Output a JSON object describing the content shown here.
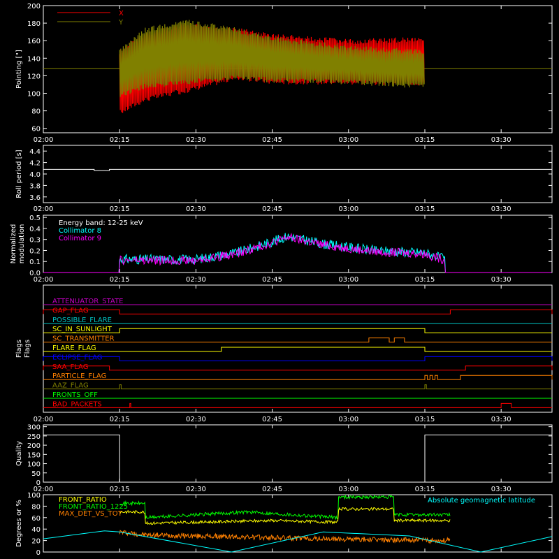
{
  "chart_data": [
    {
      "id": "pointing",
      "type": "line",
      "ylabel": "Pointing [\"]",
      "ylim": [
        55,
        200
      ],
      "yticks": [
        60,
        80,
        100,
        120,
        140,
        160,
        180,
        200
      ],
      "x_tick_labels": [
        "02:00",
        "02:15",
        "02:30",
        "02:45",
        "03:00",
        "03:15",
        "03:30"
      ],
      "legend": [
        {
          "label": "X",
          "color": "#ff0000"
        },
        {
          "label": "Y",
          "color": "#808000"
        }
      ],
      "reference_line": {
        "y": 128,
        "color": "#808000"
      },
      "series": [
        {
          "name": "X",
          "color": "#ff0000",
          "x": [
            "02:15",
            "02:20",
            "02:28",
            "02:38",
            "02:45",
            "03:00",
            "03:15"
          ],
          "upper": [
            150,
            170,
            180,
            175,
            168,
            162,
            165
          ],
          "lower": [
            75,
            90,
            100,
            115,
            110,
            110,
            108
          ]
        },
        {
          "name": "Y",
          "color": "#808000",
          "x": [
            "02:15",
            "02:20",
            "02:28",
            "02:38",
            "02:45",
            "03:00",
            "03:15"
          ],
          "upper": [
            150,
            175,
            185,
            175,
            165,
            155,
            150
          ],
          "lower": [
            95,
            105,
            110,
            115,
            112,
            110,
            105
          ]
        }
      ]
    },
    {
      "id": "roll",
      "type": "line",
      "ylabel": "Roll period [s]",
      "ylim": [
        3.5,
        4.5
      ],
      "yticks": [
        3.6,
        3.8,
        4.0,
        4.2,
        4.4
      ],
      "x_tick_labels": [
        "02:00",
        "02:15",
        "02:30",
        "02:45",
        "03:00",
        "03:15",
        "03:30"
      ],
      "series": [
        {
          "name": "roll",
          "color": "#ffffff",
          "x": [
            "02:00",
            "02:10",
            "02:10",
            "02:13",
            "02:13",
            "03:40"
          ],
          "y": [
            4.08,
            4.08,
            4.06,
            4.06,
            4.08,
            4.08
          ]
        }
      ]
    },
    {
      "id": "modulation",
      "type": "line",
      "ylabel": "Normalized modulation",
      "ylim": [
        0,
        0.52
      ],
      "yticks": [
        0.0,
        0.1,
        0.2,
        0.3,
        0.4,
        0.5
      ],
      "x_tick_labels": [
        "02:00",
        "02:15",
        "02:30",
        "02:45",
        "03:00",
        "03:15",
        "03:30"
      ],
      "annotation": "Energy band: 12-25 keV",
      "legend": [
        {
          "label": "Collimator 8",
          "color": "#00ffff"
        },
        {
          "label": "Collimator 9",
          "color": "#ff00ff"
        }
      ],
      "series": [
        {
          "name": "Collimator 8",
          "color": "#00ffff",
          "x": [
            "02:00",
            "02:15",
            "02:15",
            "02:30",
            "02:38",
            "02:45",
            "02:48",
            "02:55",
            "03:05",
            "03:15",
            "03:19",
            "03:19",
            "03:40"
          ],
          "y": [
            0,
            0,
            0.12,
            0.12,
            0.18,
            0.28,
            0.33,
            0.26,
            0.2,
            0.18,
            0.12,
            0,
            0
          ]
        },
        {
          "name": "Collimator 9",
          "color": "#ff00ff",
          "x": [
            "02:00",
            "02:15",
            "02:15",
            "02:30",
            "02:38",
            "02:45",
            "02:48",
            "02:55",
            "03:05",
            "03:15",
            "03:19",
            "03:19",
            "03:40"
          ],
          "y": [
            0,
            0,
            0.11,
            0.11,
            0.17,
            0.27,
            0.32,
            0.25,
            0.19,
            0.17,
            0.11,
            0,
            0
          ]
        }
      ]
    },
    {
      "id": "flags",
      "type": "line",
      "ylabel": "Flags",
      "x_tick_labels": [
        "02:00",
        "02:15",
        "02:30",
        "02:45",
        "03:00",
        "03:15",
        "03:30"
      ],
      "flags": [
        {
          "name": "ATTENUATOR_STATE",
          "color": "#c000c0",
          "segments": []
        },
        {
          "name": "GAP_FLAG",
          "color": "#ff0000",
          "segments": [
            [
              "02:00",
              "02:15"
            ],
            [
              "03:20",
              "03:40"
            ]
          ]
        },
        {
          "name": "POSSIBLE_FLARE",
          "color": "#00c0c0",
          "segments": []
        },
        {
          "name": "SC_IN_SUNLIGHT",
          "color": "#ffff00",
          "segments": [
            [
              "02:15",
              "03:15"
            ]
          ]
        },
        {
          "name": "SC_TRANSMITTER",
          "color": "#ff8000",
          "segments": [
            [
              "03:04",
              "03:08"
            ],
            [
              "03:09",
              "03:11"
            ]
          ]
        },
        {
          "name": "FLARE_FLAG",
          "color": "#ffff00",
          "segments": [
            [
              "02:35",
              "03:15"
            ]
          ]
        },
        {
          "name": "ECLIPSE_FLAG",
          "color": "#0000ff",
          "segments": [
            [
              "02:00",
              "02:15"
            ],
            [
              "03:15",
              "03:40"
            ]
          ]
        },
        {
          "name": "SAA_FLAG",
          "color": "#ff0000",
          "segments": [
            [
              "02:00",
              "02:13"
            ],
            [
              "03:23",
              "03:40"
            ]
          ]
        },
        {
          "name": "PARTICLE_FLAG",
          "color": "#ff8000",
          "segments": [
            [
              "03:15",
              "03:15.5"
            ],
            [
              "03:16",
              "03:16.5"
            ],
            [
              "03:17",
              "03:17.5"
            ],
            [
              "03:22",
              "03:40"
            ]
          ]
        },
        {
          "name": "AAZ_FLAG",
          "color": "#808000",
          "segments": [
            [
              "02:15",
              "02:15.3"
            ],
            [
              "03:15",
              "03:15.3"
            ]
          ]
        },
        {
          "name": "FRONTS_OFF",
          "color": "#00ff00",
          "segments": []
        },
        {
          "name": "BAD_PACKETS",
          "color": "#ff0000",
          "segments": [
            [
              "02:17",
              "02:17.2"
            ],
            [
              "03:30",
              "03:32"
            ]
          ]
        }
      ]
    },
    {
      "id": "quality",
      "type": "line",
      "ylabel": "Quality",
      "ylim": [
        0,
        310
      ],
      "yticks": [
        0,
        50,
        100,
        150,
        200,
        250,
        300
      ],
      "x_tick_labels": [
        "02:00",
        "02:15",
        "02:30",
        "02:45",
        "03:00",
        "03:15",
        "03:30"
      ],
      "series": [
        {
          "name": "quality",
          "color": "#ffffff",
          "x": [
            "02:00",
            "02:15",
            "02:15",
            "03:15",
            "03:15",
            "03:40"
          ],
          "y": [
            255,
            255,
            0,
            0,
            255,
            255
          ]
        }
      ]
    },
    {
      "id": "ratios",
      "type": "line",
      "ylabel": "Degrees or %",
      "ylim": [
        0,
        100
      ],
      "yticks": [
        0,
        20,
        40,
        60,
        80,
        100
      ],
      "x_tick_labels": [
        "02:00",
        "02:15",
        "02:30",
        "02:45",
        "03:00",
        "03:15",
        "03:30"
      ],
      "legend": [
        {
          "label": "FRONT_RATIO",
          "color": "#ffff00"
        },
        {
          "label": "FRONT_RATIO_1225",
          "color": "#00ff00"
        },
        {
          "label": "MAX_DET_VS_TOT",
          "color": "#ff8000"
        }
      ],
      "right_legend": {
        "label": "Absolute geomagnetic latitude",
        "color": "#00ffff"
      },
      "series": [
        {
          "name": "FRONT_RATIO",
          "color": "#ffff00",
          "x": [
            "02:15",
            "02:20",
            "02:20",
            "02:45",
            "02:58",
            "02:58",
            "03:09",
            "03:09",
            "03:20"
          ],
          "y": [
            70,
            70,
            50,
            55,
            52,
            75,
            75,
            55,
            55
          ]
        },
        {
          "name": "FRONT_RATIO_1225",
          "color": "#00ff00",
          "x": [
            "02:15",
            "02:20",
            "02:20",
            "02:40",
            "02:58",
            "02:58",
            "03:09",
            "03:09",
            "03:20"
          ],
          "y": [
            85,
            85,
            60,
            70,
            60,
            96,
            96,
            65,
            65
          ]
        },
        {
          "name": "MAX_DET_VS_TOT",
          "color": "#ff8000",
          "x": [
            "02:15",
            "02:20",
            "02:45",
            "03:00",
            "03:20"
          ],
          "y": [
            35,
            30,
            25,
            22,
            20
          ]
        },
        {
          "name": "Absolute geomagnetic latitude",
          "color": "#00ffff",
          "x": [
            "02:00",
            "02:12",
            "02:15",
            "02:37",
            "02:55",
            "03:12",
            "03:26",
            "03:40"
          ],
          "y": [
            23,
            37,
            35,
            0,
            35,
            28,
            0,
            27
          ]
        }
      ]
    }
  ]
}
